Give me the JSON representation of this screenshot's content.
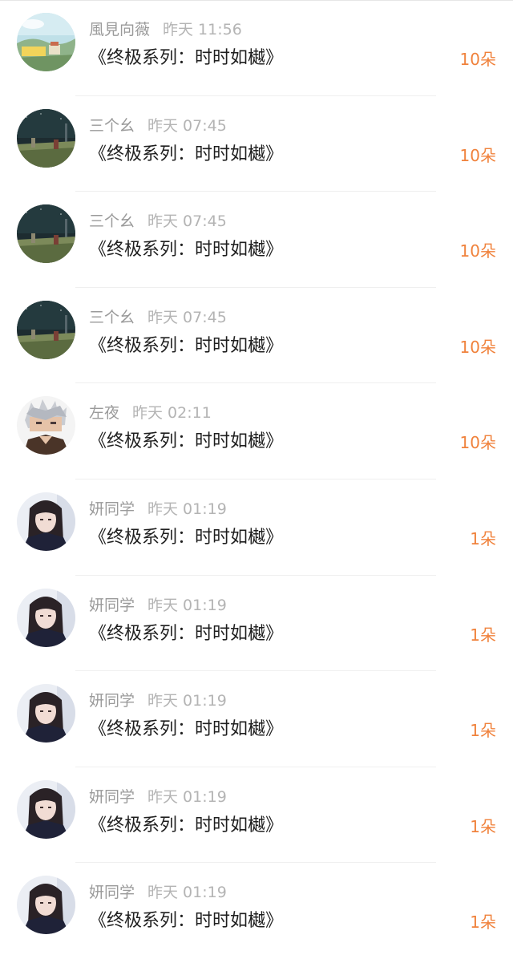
{
  "records": [
    {
      "name": "風見向薇",
      "time": "昨天 11:56",
      "gift": "《终极系列：时时如樾》",
      "amount": "10朵",
      "avatar": "landscape-avatar"
    },
    {
      "name": "三个幺",
      "time": "昨天 07:45",
      "gift": "《终极系列：时时如樾》",
      "amount": "10朵",
      "avatar": "night-field-avatar"
    },
    {
      "name": "三个幺",
      "time": "昨天 07:45",
      "gift": "《终极系列：时时如樾》",
      "amount": "10朵",
      "avatar": "night-field-avatar"
    },
    {
      "name": "三个幺",
      "time": "昨天 07:45",
      "gift": "《终极系列：时时如樾》",
      "amount": "10朵",
      "avatar": "night-field-avatar"
    },
    {
      "name": "左夜",
      "time": "昨天 02:11",
      "gift": "《终极系列：时时如樾》",
      "amount": "10朵",
      "avatar": "anime-character-avatar"
    },
    {
      "name": "妍同学",
      "time": "昨天 01:19",
      "gift": "《终极系列：时时如樾》",
      "amount": "1朵",
      "avatar": "girl-portrait-avatar"
    },
    {
      "name": "妍同学",
      "time": "昨天 01:19",
      "gift": "《终极系列：时时如樾》",
      "amount": "1朵",
      "avatar": "girl-portrait-avatar"
    },
    {
      "name": "妍同学",
      "time": "昨天 01:19",
      "gift": "《终极系列：时时如樾》",
      "amount": "1朵",
      "avatar": "girl-portrait-avatar"
    },
    {
      "name": "妍同学",
      "time": "昨天 01:19",
      "gift": "《终极系列：时时如樾》",
      "amount": "1朵",
      "avatar": "girl-portrait-avatar"
    },
    {
      "name": "妍同学",
      "time": "昨天 01:19",
      "gift": "《终极系列：时时如樾》",
      "amount": "1朵",
      "avatar": "girl-portrait-avatar"
    }
  ],
  "colors": {
    "amount": "#f0823c",
    "name": "#9a9a9a",
    "time": "#b4b4b4",
    "title": "#1f1f1f",
    "divider": "#efefef"
  }
}
